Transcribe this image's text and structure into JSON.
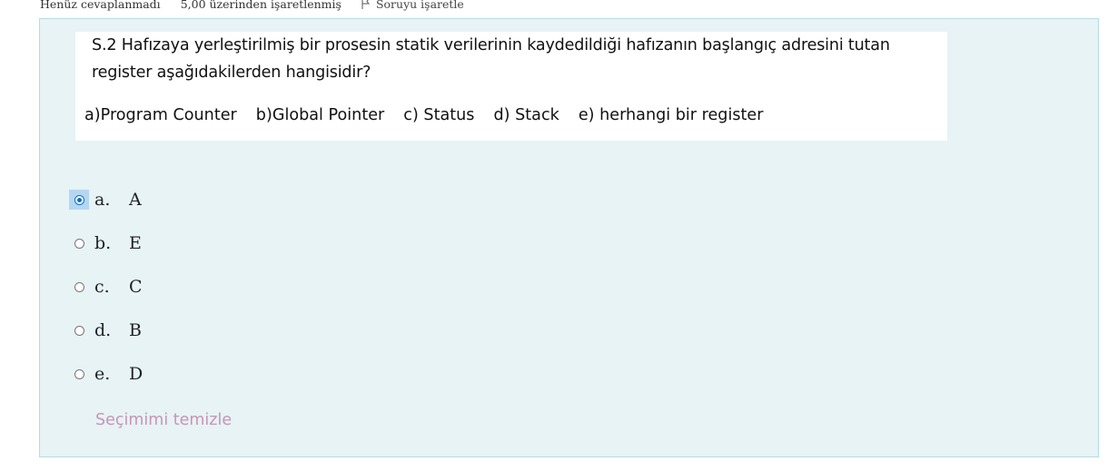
{
  "info": {
    "status": "Henüz cevaplanmadı",
    "mark": "5,00 üzerinden işaretlenmiş",
    "flag_label": "Soruyu işaretle"
  },
  "question": {
    "line1": "S.2 Hafızaya yerleştirilmiş bir prosesin statik verilerinin kaydedildiği hafızanın başlangıç adresini tutan",
    "line2": "register aşağıdakilerden hangisidir?",
    "choices": [
      "a)Program Counter",
      "b)Global Pointer",
      "c) Status",
      "d) Stack",
      "e) herhangi bir register"
    ]
  },
  "answers": [
    {
      "letter": "a.",
      "text": "A",
      "checked": true
    },
    {
      "letter": "b.",
      "text": "E",
      "checked": false
    },
    {
      "letter": "c.",
      "text": "C",
      "checked": false
    },
    {
      "letter": "d.",
      "text": "B",
      "checked": false
    },
    {
      "letter": "e.",
      "text": "D",
      "checked": false
    }
  ],
  "clear_label": "Seçimimi temizle",
  "colors": {
    "panel_bg": "#e7f3f5",
    "panel_border": "#b8dce2",
    "link": "#c795b6",
    "radio_accent": "#0f6cbf"
  }
}
